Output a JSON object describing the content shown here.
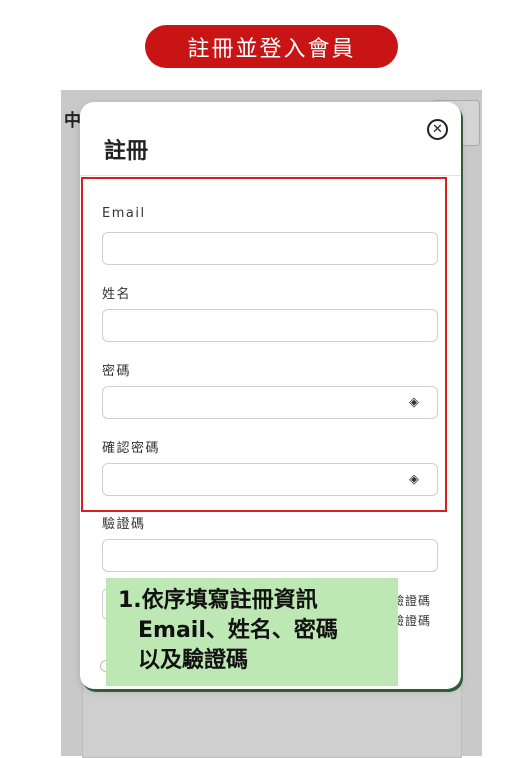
{
  "banner": {
    "text": "註冊並登入會員"
  },
  "background": {
    "partial_char": "中"
  },
  "modal": {
    "title": "註冊",
    "fields": [
      {
        "label": "Email",
        "value": "",
        "has_eye": false
      },
      {
        "label": "姓名",
        "value": "",
        "has_eye": false
      },
      {
        "label": "密碼",
        "value": "",
        "has_eye": true
      },
      {
        "label": "確認密碼",
        "value": "",
        "has_eye": true
      },
      {
        "label": "驗證碼",
        "value": "",
        "has_eye": false
      }
    ],
    "captcha_side_lines": [
      "驗證碼",
      "驗證碼"
    ]
  },
  "annotation": {
    "line1": "1.依序填寫註冊資訊",
    "line2": "Email、姓名、密碼",
    "line3": "以及驗證碼",
    "highlight_color": "#d62020",
    "note_color": "#bde7b3"
  },
  "colors": {
    "banner": "#c81414",
    "overlay": "#c9c9c9",
    "modal_shadow": "#2f5d3a"
  }
}
